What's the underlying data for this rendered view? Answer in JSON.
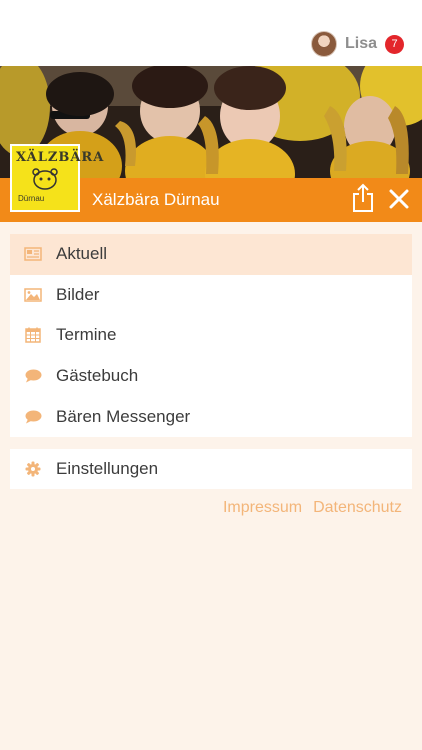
{
  "user": {
    "name": "Lisa",
    "notifications": "7"
  },
  "club": {
    "name": "Xälzbära Dürnau",
    "logo_text": "XÄLZBÄRA",
    "logo_sub": "Dürnau"
  },
  "menu": {
    "items": [
      {
        "label": "Aktuell",
        "icon": "newspaper-icon",
        "active": true
      },
      {
        "label": "Bilder",
        "icon": "image-icon"
      },
      {
        "label": "Termine",
        "icon": "calendar-icon"
      },
      {
        "label": "Gästebuch",
        "icon": "speech-bubble-icon"
      },
      {
        "label": "Bären Messenger",
        "icon": "speech-bubble-icon"
      }
    ],
    "settings_label": "Einstellungen"
  },
  "footer": {
    "impressum": "Impressum",
    "datenschutz": "Datenschutz"
  },
  "colors": {
    "accent": "#f28a18",
    "icon": "#f3b579",
    "active_bg": "#fde6d3",
    "badge": "#e3262b",
    "background": "#fdf3ea"
  }
}
